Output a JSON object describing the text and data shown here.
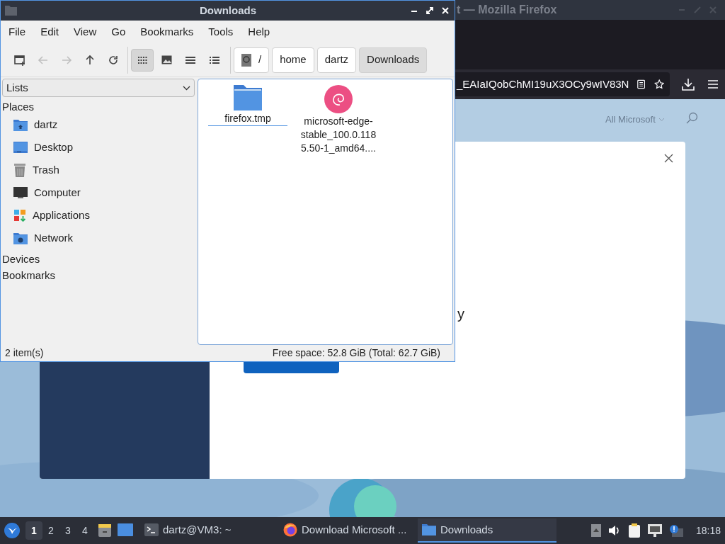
{
  "browser_window": {
    "title": "t — Mozilla Firefox",
    "url": "_EAIaIQobChMI19uX3OCy9wIV83N",
    "nav_link": "All Microsoft",
    "dialog_text": "y"
  },
  "file_manager": {
    "title": "Downloads",
    "menu": [
      "File",
      "Edit",
      "View",
      "Go",
      "Bookmarks",
      "Tools",
      "Help"
    ],
    "toolbar": [
      {
        "kind": "new-tab",
        "disabled": false
      },
      {
        "kind": "back",
        "disabled": true
      },
      {
        "kind": "forward",
        "disabled": true
      },
      {
        "kind": "up",
        "disabled": false
      },
      {
        "kind": "reload",
        "disabled": false
      }
    ],
    "view_modes": [
      {
        "kind": "icons",
        "selected": true
      },
      {
        "kind": "thumbnails",
        "selected": false
      },
      {
        "kind": "compact",
        "selected": false
      },
      {
        "kind": "details",
        "selected": false
      }
    ],
    "path": [
      {
        "label": "/",
        "kind": "root",
        "selected": false
      },
      {
        "label": "home",
        "kind": "folder",
        "selected": false
      },
      {
        "label": "dartz",
        "kind": "folder",
        "selected": false
      },
      {
        "label": "Downloads",
        "kind": "folder",
        "selected": true
      }
    ],
    "side_pane_mode": "Lists",
    "sections": [
      {
        "title": "Places",
        "items": [
          {
            "label": "dartz",
            "kind": "home"
          },
          {
            "label": "Desktop",
            "kind": "desktop"
          },
          {
            "label": "Trash",
            "kind": "trash"
          },
          {
            "label": "Computer",
            "kind": "computer"
          },
          {
            "label": "Applications",
            "kind": "applications"
          },
          {
            "label": "Network",
            "kind": "network"
          }
        ]
      },
      {
        "title": "Devices"
      },
      {
        "title": "Bookmarks"
      }
    ],
    "files": [
      {
        "name": "firefox.tmp",
        "kind": "folder",
        "focused": true
      },
      {
        "name": "microsoft-edge-stable_100.0.1185.50-1_amd64....",
        "kind": "package",
        "focused": false
      }
    ],
    "status": {
      "items": "2 item(s)",
      "free_space": "Free space: 52.8 GiB (Total: 62.7 GiB)"
    }
  },
  "taskbar": {
    "workspaces": [
      {
        "label": "1",
        "selected": true
      },
      {
        "label": "2",
        "selected": false
      },
      {
        "label": "3",
        "selected": false
      },
      {
        "label": "4",
        "selected": false
      }
    ],
    "launchers": [
      {
        "kind": "file-manager"
      },
      {
        "kind": "desktop"
      }
    ],
    "tasks": [
      {
        "label": "dartz@VM3: ~",
        "kind": "terminal",
        "selected": false
      },
      {
        "label": "Download Microsoft ...",
        "kind": "firefox",
        "selected": false
      },
      {
        "label": "Downloads",
        "kind": "folder",
        "selected": true
      }
    ],
    "tray": [
      {
        "kind": "arrow"
      },
      {
        "kind": "volume"
      },
      {
        "kind": "clipboard"
      },
      {
        "kind": "network"
      },
      {
        "kind": "notification"
      }
    ],
    "clock": "18:18"
  }
}
